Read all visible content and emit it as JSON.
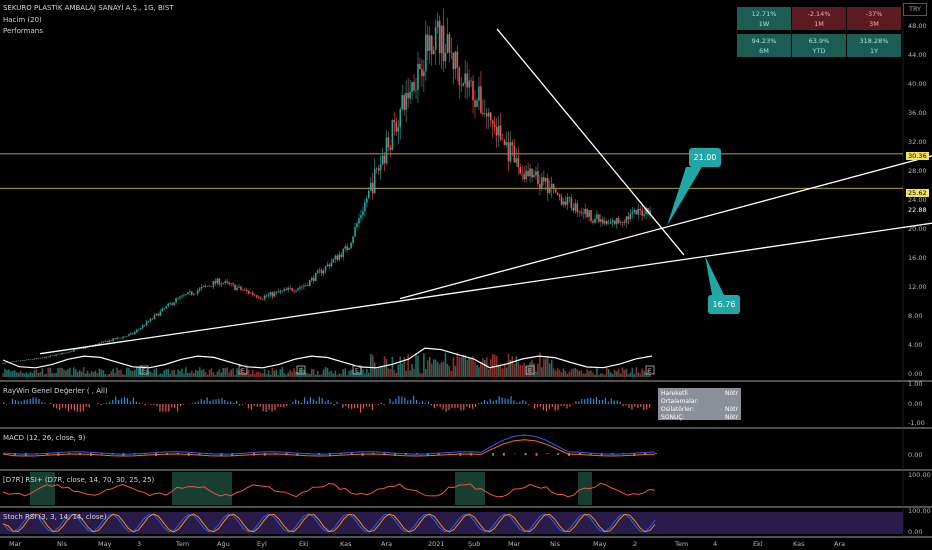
{
  "header": {
    "title": "SEKURO PLASTİK AMBALAJ SANAYİ A.Ş., 1G, BIST",
    "volume": "Hacim (20)",
    "performance": "Performans",
    "currency": "TRY"
  },
  "performance_cells": [
    {
      "value": "12.71%",
      "period": "1W",
      "tone": "pos"
    },
    {
      "value": "-2.14%",
      "period": "1M",
      "tone": "neg"
    },
    {
      "value": "-37%",
      "period": "3M",
      "tone": "neg"
    },
    {
      "value": "94.23%",
      "period": "6M",
      "tone": "pos"
    },
    {
      "value": "63.9%",
      "period": "YTD",
      "tone": "pos"
    },
    {
      "value": "318.28%",
      "period": "1Y",
      "tone": "pos"
    }
  ],
  "annotations": {
    "upper_target": "21.00",
    "lower_target": "16.76"
  },
  "price_labels": {
    "line_high": "30.36",
    "line_mid": "25.62",
    "last_price": "22.88"
  },
  "tooltip": {
    "rows": [
      {
        "label": "Hareketli Ortalamalar:",
        "value": "Nötr"
      },
      {
        "label": "Osilatörler:",
        "value": "Nötr"
      },
      {
        "label": "SONUÇ:",
        "value": "Nötr"
      }
    ]
  },
  "indicators": {
    "raywin": "RayWin Genel Değerler ( , All)",
    "macd": "MACD (12, 26, close, 9)",
    "rsi": "[D7R] RSI+ (D7R, close, 14, 70, 30, 25, 25)",
    "stoch": "Stoch RSI (3, 3, 14, 14, close)"
  },
  "chart_data": {
    "type": "candlestick",
    "y_ticks": [
      "52.00",
      "48.00",
      "44.00",
      "40.00",
      "36.00",
      "32.00",
      "28.00",
      "24.00",
      "20.00",
      "16.00",
      "12.00",
      "8.00",
      "4.00",
      "0.00"
    ],
    "raywin_ticks": [
      "1.00",
      "0.00",
      "-1.00"
    ],
    "macd_ticks": [
      "0.00"
    ],
    "rsi_ticks": [
      "100.00"
    ],
    "stoch_ticks": [
      "100.00",
      "0.00"
    ],
    "x_ticks": [
      "Mar",
      "Nis",
      "May",
      "3",
      "Tem",
      "Ağu",
      "Eyl",
      "Eki",
      "Kas",
      "Ara",
      "2021",
      "Şub",
      "Mar",
      "Nis",
      "May",
      "2",
      "Tem",
      "4",
      "Ekl",
      "Kas",
      "Ara"
    ],
    "horizontal_levels": [
      30.36,
      25.62
    ],
    "last_price": 22.88,
    "ylim": [
      0,
      52
    ],
    "price_path": [
      [
        "2020-03",
        1.5
      ],
      [
        "2020-05",
        2.3
      ],
      [
        "2020-07",
        3.8
      ],
      [
        "2020-08",
        5.5
      ],
      [
        "2020-09",
        10.2
      ],
      [
        "2020-10",
        12.8
      ],
      [
        "2020-11",
        10.6
      ],
      [
        "2020-12",
        12.2
      ],
      [
        "2021-01",
        17.5
      ],
      [
        "2021-02",
        33.0
      ],
      [
        "2021-02-20",
        47.5
      ],
      [
        "2021-03",
        38.0
      ],
      [
        "2021-04",
        28.0
      ],
      [
        "2021-05",
        24.0
      ],
      [
        "2021-06",
        20.5
      ],
      [
        "2021-06-20",
        22.88
      ]
    ]
  }
}
